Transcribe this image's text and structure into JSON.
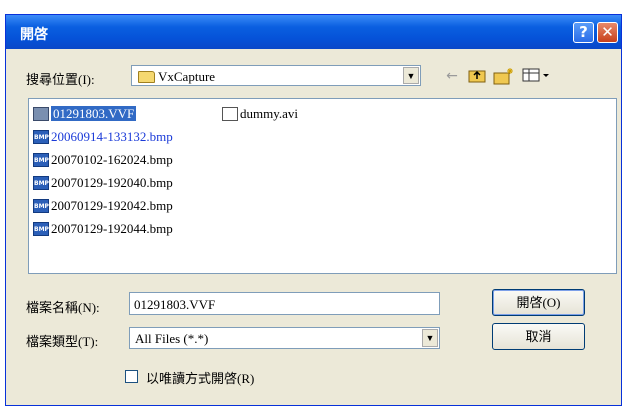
{
  "window": {
    "title": "開啓"
  },
  "titlebar": {
    "help_label": "?",
    "close_label": "✕"
  },
  "lookin": {
    "label": "搜尋位置(I):",
    "value": "VxCapture"
  },
  "toolbar": {
    "back_icon": "back-arrow-icon",
    "up_icon": "up-folder-icon",
    "new_folder_icon": "new-folder-icon",
    "view_menu_icon": "view-menu-icon"
  },
  "files": [
    {
      "name": "01291803.VVF",
      "type": "vvf",
      "selected": true
    },
    {
      "name": "20060914-133132.bmp",
      "type": "bmp",
      "highlight": true
    },
    {
      "name": "20070102-162024.bmp",
      "type": "bmp"
    },
    {
      "name": "20070129-192040.bmp",
      "type": "bmp"
    },
    {
      "name": "20070129-192042.bmp",
      "type": "bmp"
    },
    {
      "name": "20070129-192044.bmp",
      "type": "bmp"
    },
    {
      "name": "dummy.avi",
      "type": "avi"
    }
  ],
  "filename": {
    "label": "檔案名稱(N):",
    "value": "01291803.VVF"
  },
  "filetype": {
    "label": "檔案類型(T):",
    "value": "All Files (*.*)"
  },
  "readonly": {
    "label": "以唯讀方式開啓(R)",
    "checked": false
  },
  "buttons": {
    "open_label": "開啓(O)",
    "cancel_label": "取消"
  }
}
